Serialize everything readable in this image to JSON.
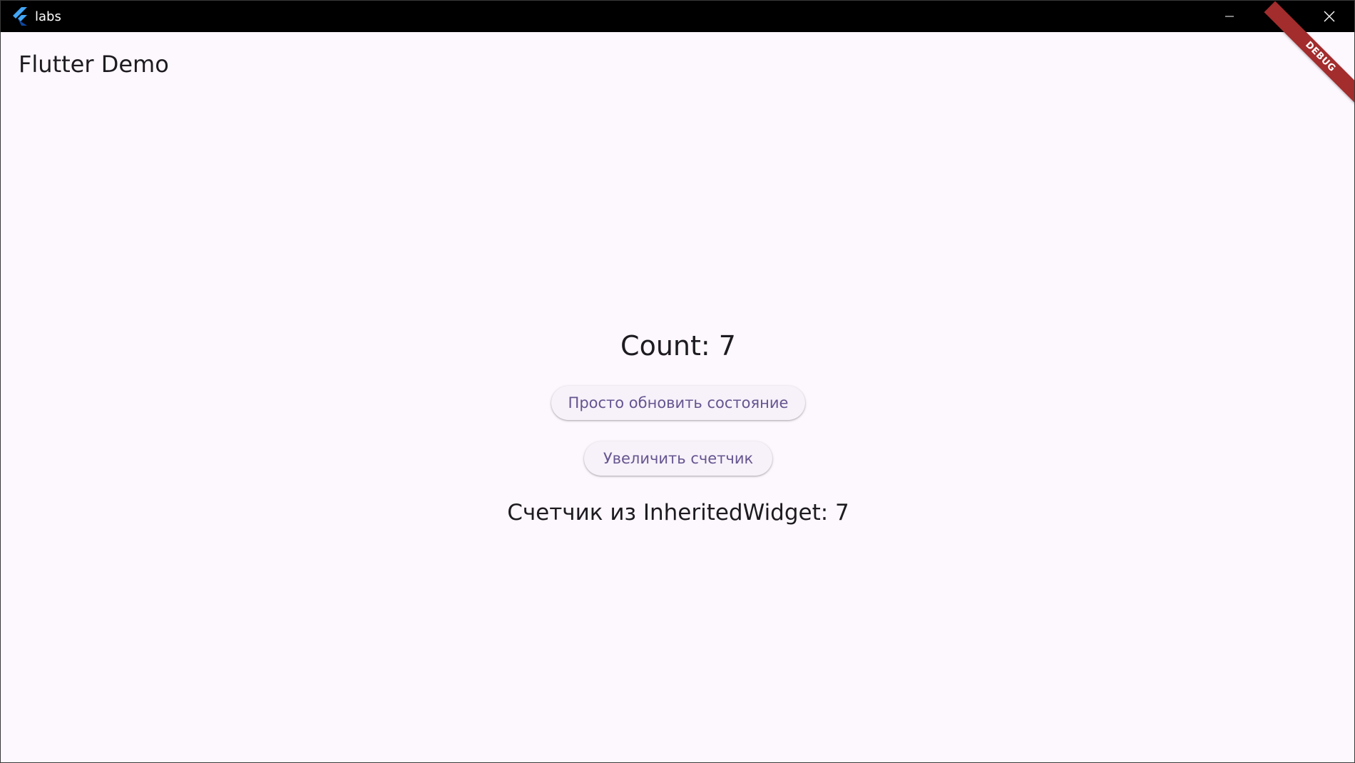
{
  "window": {
    "title": "labs",
    "icon": "flutter-logo-icon",
    "controls": [
      "minimize-icon",
      "maximize-icon",
      "close-icon"
    ]
  },
  "appbar": {
    "title": "Flutter Demo"
  },
  "debug_banner": {
    "label": "DEBUG"
  },
  "main": {
    "count_text": "Count: 7",
    "refresh_button_label": "Просто обновить состояние",
    "increment_button_label": "Увеличить счетчик",
    "inherited_text": "Счетчик из InheritedWidget: 7"
  },
  "colors": {
    "background": "#fdf7fe",
    "titlebar": "#000000",
    "button_text": "#65558f",
    "button_bg": "#f7f1fa",
    "debug_banner": "#a32c2c",
    "text": "#1d1b20"
  }
}
